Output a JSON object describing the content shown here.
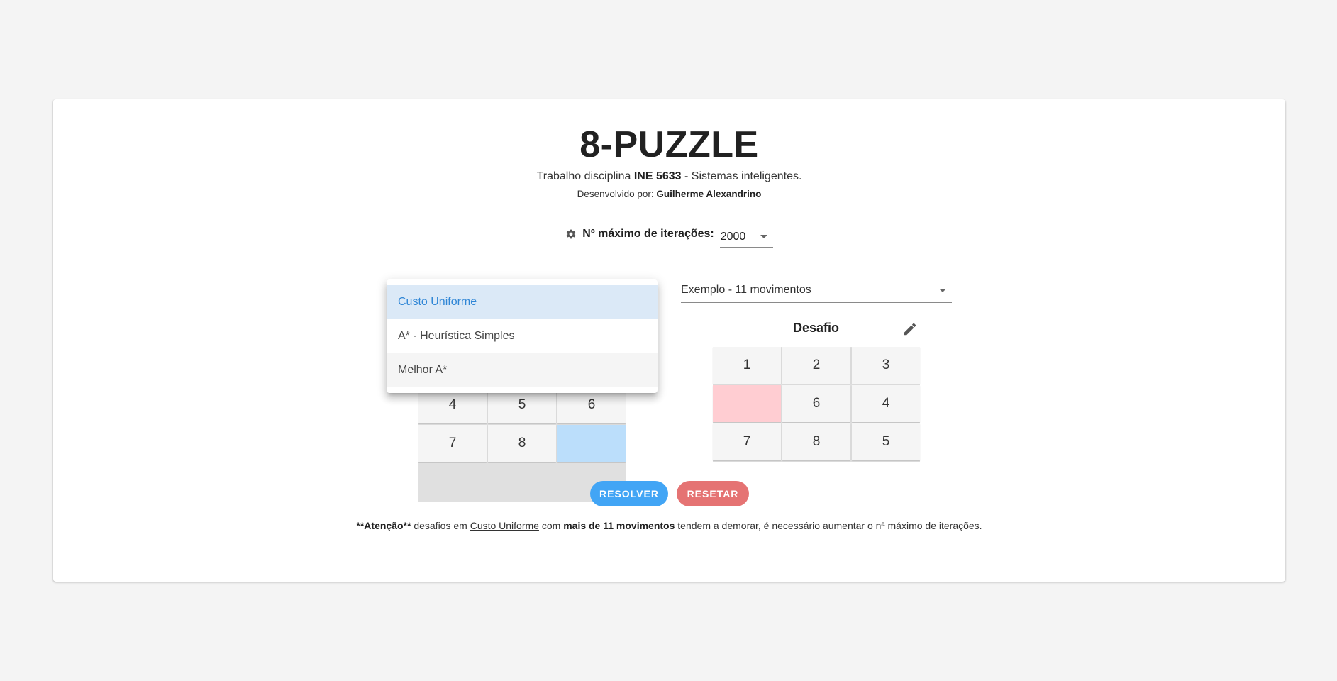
{
  "header": {
    "title": "8-PUZZLE",
    "subtitle_prefix": "Trabalho disciplina ",
    "subtitle_course": "INE 5633",
    "subtitle_suffix": " - Sistemas inteligentes.",
    "author_prefix": "Desenvolvido por: ",
    "author_name": "Guilherme Alexandrino"
  },
  "settings": {
    "icon": "gear-icon",
    "iterations_label": "Nº máximo de iterações:",
    "iterations_value": "2000"
  },
  "algorithm_menu": {
    "items": [
      "Custo Uniforme",
      "A* - Heurística Simples",
      "Melhor A*"
    ],
    "selected": "Custo Uniforme"
  },
  "example_select": {
    "value": "Exemplo - 11 movimentos"
  },
  "goal_board": {
    "visible_rows": [
      [
        "4",
        "5",
        "6"
      ],
      [
        "7",
        "8",
        ""
      ]
    ]
  },
  "challenge_board": {
    "title": "Desafio",
    "edit_icon": "pencil-icon",
    "cells": [
      "1",
      "2",
      "3",
      "",
      "6",
      "4",
      "7",
      "8",
      "5"
    ]
  },
  "buttons": {
    "solve": "RESOLVER",
    "reset": "RESETAR"
  },
  "note": {
    "part1": "**Atenção**",
    "part2": " desafios em ",
    "part3": "Custo Uniforme",
    "part4": " com ",
    "part5": "mais de 11 movimentos",
    "part6": " tendem a demorar, é necessário aumentar o nª máximo de iterações."
  },
  "colors": {
    "solve": "#42a5f5",
    "reset": "#e57373",
    "goal_blank": "#bbdefb",
    "challenge_blank": "#ffcdd2",
    "menu_active_bg": "#dbe9f7",
    "menu_active_text": "#2f86d6"
  }
}
